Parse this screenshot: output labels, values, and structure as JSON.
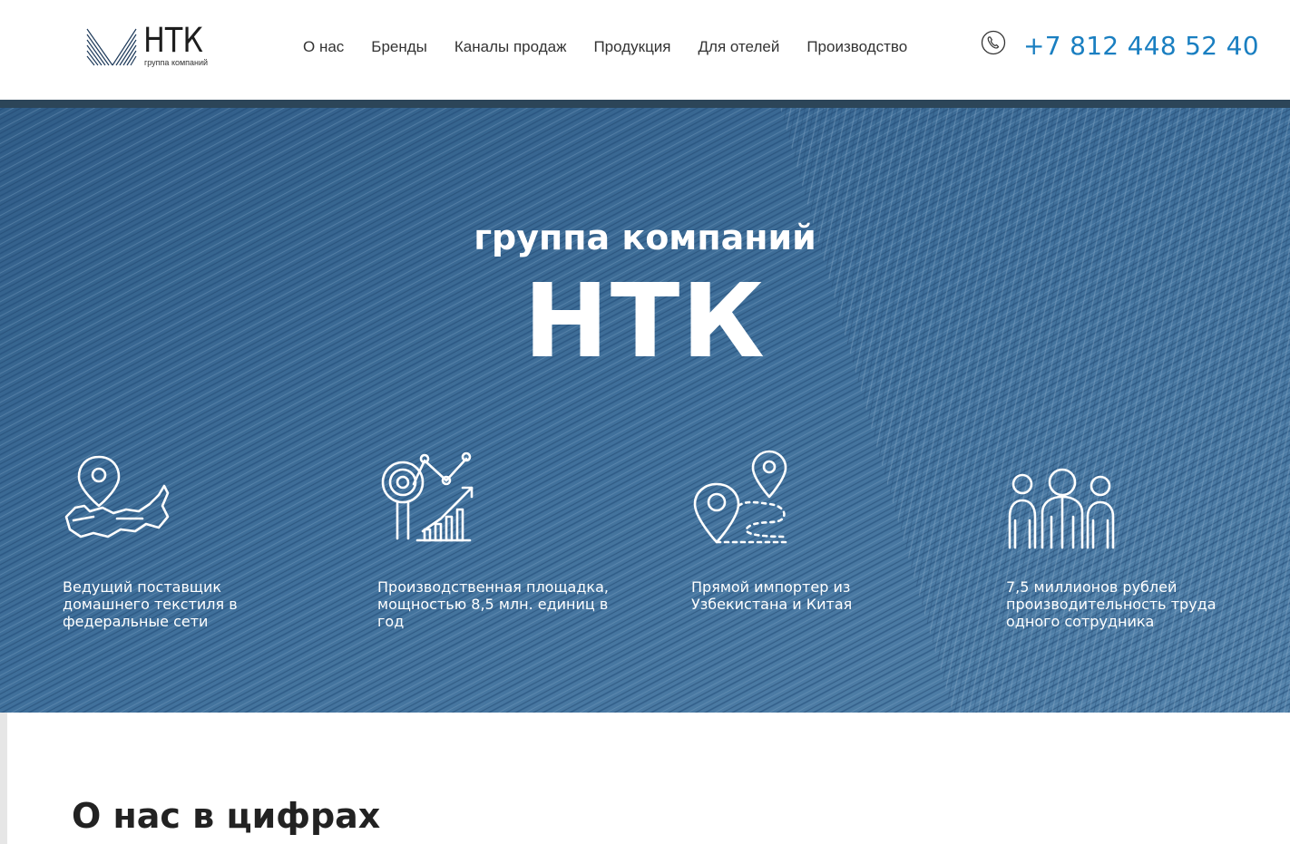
{
  "header": {
    "logo_title": "НТК",
    "logo_sub": "группа компаний",
    "nav": [
      "О нас",
      "Бренды",
      "Каналы продаж",
      "Продукция",
      "Для отелей",
      "Производство"
    ],
    "phone": "+7 812 448 52 40",
    "phone_icon": "phone-icon"
  },
  "hero": {
    "subtitle": "группа компаний",
    "title": "НТК",
    "features": [
      {
        "icon": "russia-map-pin-icon",
        "text": "Ведущий поставщик домашнего текстиля в федеральные сети"
      },
      {
        "icon": "growth-chart-target-icon",
        "text": "Производственная площадка, мощностью 8,5 млн. единиц в год"
      },
      {
        "icon": "route-pins-icon",
        "text": "Прямой импортер из Узбекистана и Китая"
      },
      {
        "icon": "team-people-icon",
        "text": "7,5 миллионов рублей производительность труда одного сотрудника"
      }
    ]
  },
  "about": {
    "title": "О нас в цифрах"
  },
  "colors": {
    "accent": "#1a7fc1",
    "hero_bar": "#2c4558",
    "hero_bg": "#3f6d97"
  }
}
